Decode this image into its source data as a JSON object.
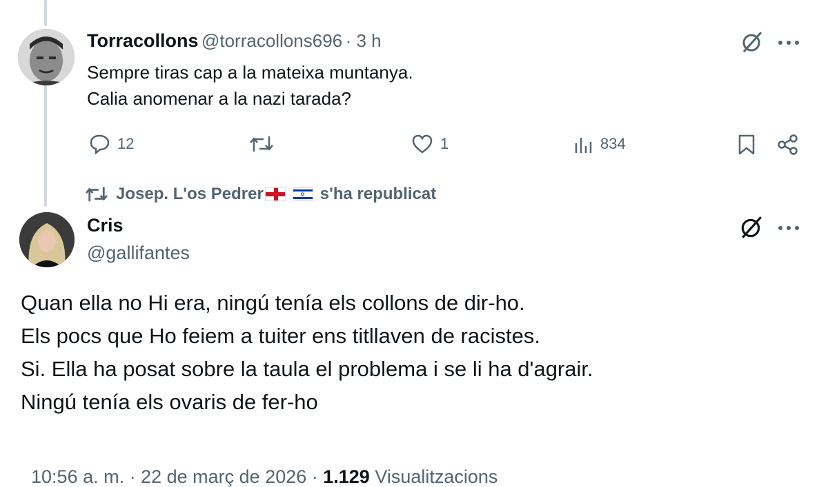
{
  "reply_tweet": {
    "author_name": "Torracollons",
    "handle": "@torracollons696",
    "time": "· 3 h",
    "lines": [
      "Sempre tiras cap a la mateixa muntanya.",
      "Calia anomenar a la nazi tarada?"
    ],
    "actions": {
      "replies": "12",
      "likes": "1",
      "views": "834"
    }
  },
  "repost_banner": {
    "reposter": "Josep. L'os Pedrer",
    "flags": [
      "🏴󠁧󠁢󠁥󠁮󠁧󠁿",
      "🇮🇱"
    ],
    "suffix": "s'ha republicat"
  },
  "main_tweet": {
    "author_name": "Cris",
    "handle": "@gallifantes",
    "lines": [
      "Quan ella no Hi era, ningú tenía els collons de dir-ho.",
      "Els pocs que Ho feiem a tuiter ens titllaven de racistes.",
      "Si. Ella ha posat sobre la taula el problema i se li ha d'agrair.",
      "Ningú tenía els ovaris de fer-ho"
    ],
    "timestamp": "10:56 a. m. · 22 de març de 2026 · ",
    "views_count": "1.129",
    "views_label": " Visualitzacions"
  },
  "icons": [
    "grok-icon",
    "more-icon",
    "reply-icon",
    "retweet-icon",
    "like-icon",
    "views-icon",
    "bookmark-icon",
    "share-icon"
  ],
  "colors": {
    "text": "#0f1419",
    "muted": "#536471",
    "thread": "#cfd9de"
  }
}
